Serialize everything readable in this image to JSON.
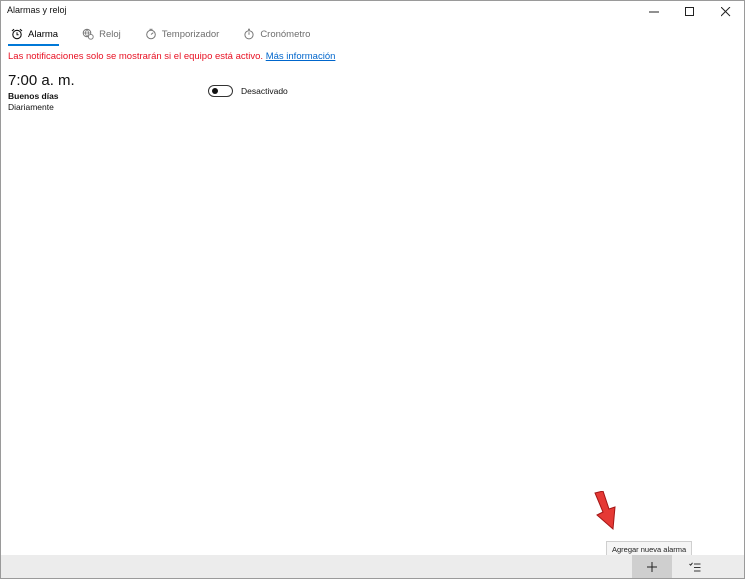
{
  "window": {
    "title": "Alarmas y reloj"
  },
  "tabs": [
    {
      "label": "Alarma",
      "icon": "alarm-clock-icon",
      "active": true
    },
    {
      "label": "Reloj",
      "icon": "world-clock-icon",
      "active": false
    },
    {
      "label": "Temporizador",
      "icon": "timer-icon",
      "active": false
    },
    {
      "label": "Cronómetro",
      "icon": "stopwatch-icon",
      "active": false
    }
  ],
  "notice": {
    "text": "Las notificaciones solo se mostrarán si el equipo está activo.",
    "link": "Más información"
  },
  "alarm": {
    "time": "7:00 a. m.",
    "name": "Buenos días",
    "repeat": "Diariamente",
    "toggle_state": "Desactivado",
    "enabled": false
  },
  "bottombar": {
    "tooltip": "Agregar nueva alarma",
    "add_icon": "plus-icon",
    "select_icon": "select-list-icon"
  },
  "colors": {
    "accent": "#0078d7",
    "warning": "#e81123",
    "link": "#0066cc",
    "annotation_arrow": "#e53935"
  }
}
